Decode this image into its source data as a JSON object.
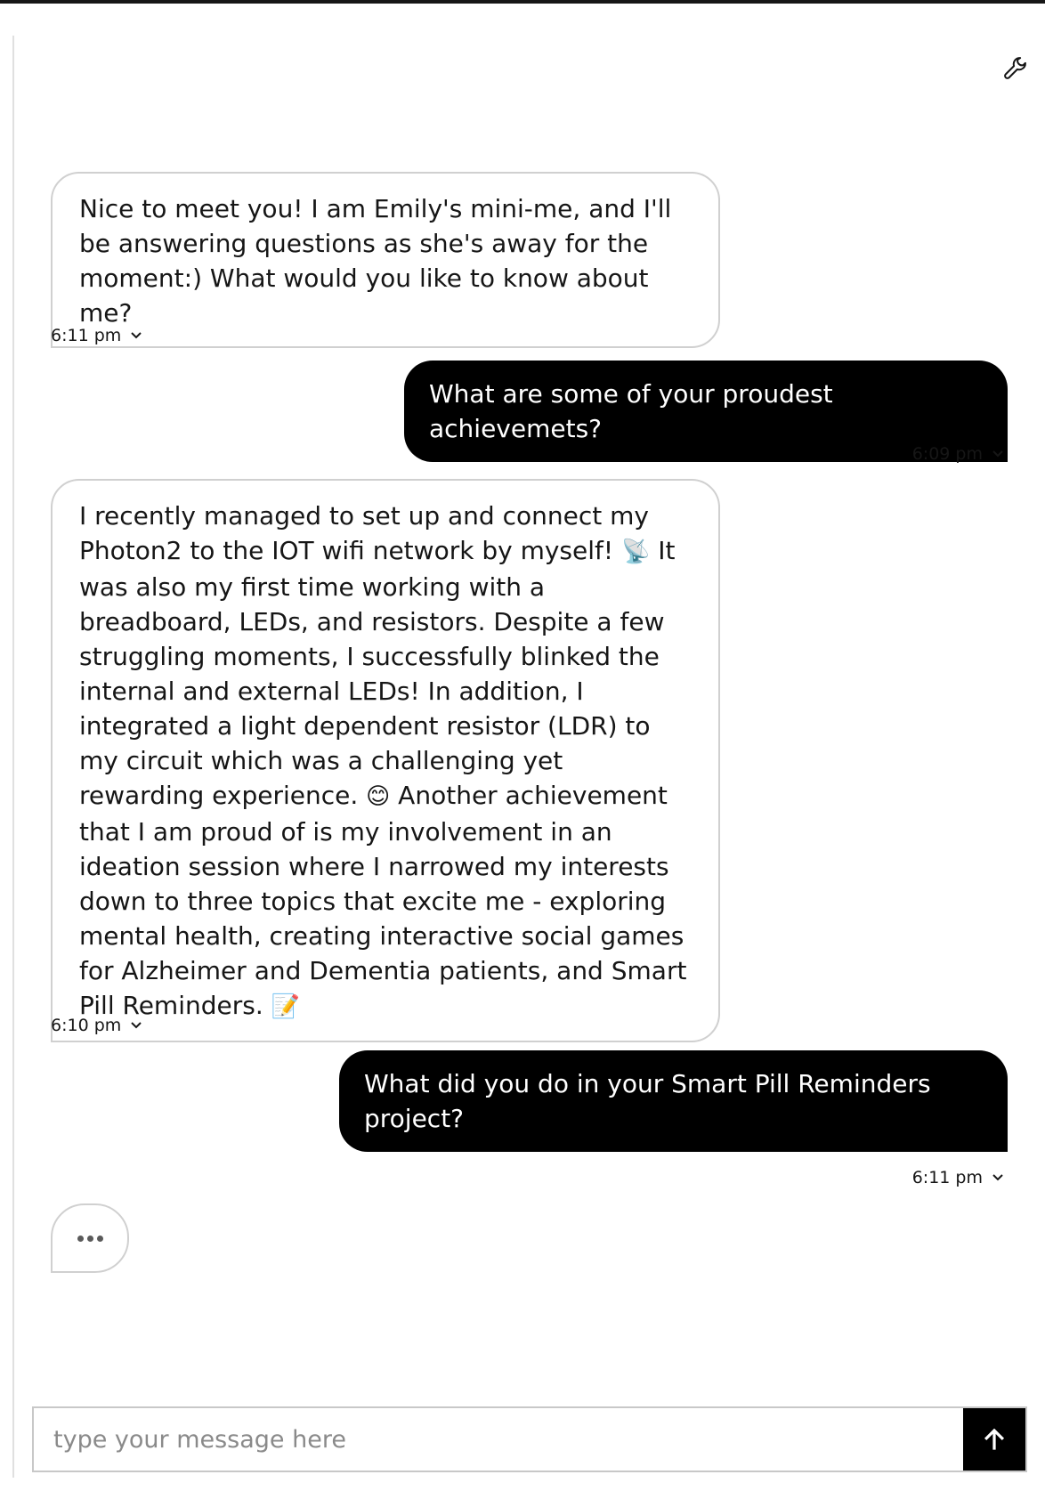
{
  "messages": [
    {
      "role": "bot",
      "text": "Nice to meet you! I am Emily's mini-me, and I'll be answering questions as she's away for the moment:) What would you like to know about me?",
      "time": "6:11 pm"
    },
    {
      "role": "user",
      "text": "What are some of your proudest achievemets?",
      "time": "6:09 pm"
    },
    {
      "role": "bot",
      "text_parts": [
        "I recently managed to set up and connect my Photon2 to the IOT wifi network by myself! ",
        " It was also my first time working with a breadboard, LEDs, and resistors. Despite a few struggling moments, I successfully blinked the internal and external LEDs! In addition, I integrated a light dependent resistor (LDR) to my circuit which was a challenging yet rewarding experience. ",
        " Another achievement that I am proud of is my involvement in an ideation session where I narrowed my interests down to three topics that excite me - exploring mental health, creating interactive social games for Alzheimer and Dementia patients, and Smart Pill Reminders. "
      ],
      "emojis": [
        "📡",
        "😊",
        "📝"
      ],
      "time": "6:10 pm"
    },
    {
      "role": "user",
      "text": "What did you do in your Smart Pill Reminders project?",
      "time": "6:11 pm"
    }
  ],
  "composer": {
    "placeholder": "type your message here"
  },
  "icons": {
    "settings": "wrench-icon",
    "send": "arrow-up-icon",
    "timestamp_toggle": "chevron-down-icon",
    "typing": "ellipsis-icon"
  },
  "colors": {
    "user_bubble": "#000000",
    "bot_bubble_border": "#d0d0d0",
    "send_button": "#000000"
  }
}
